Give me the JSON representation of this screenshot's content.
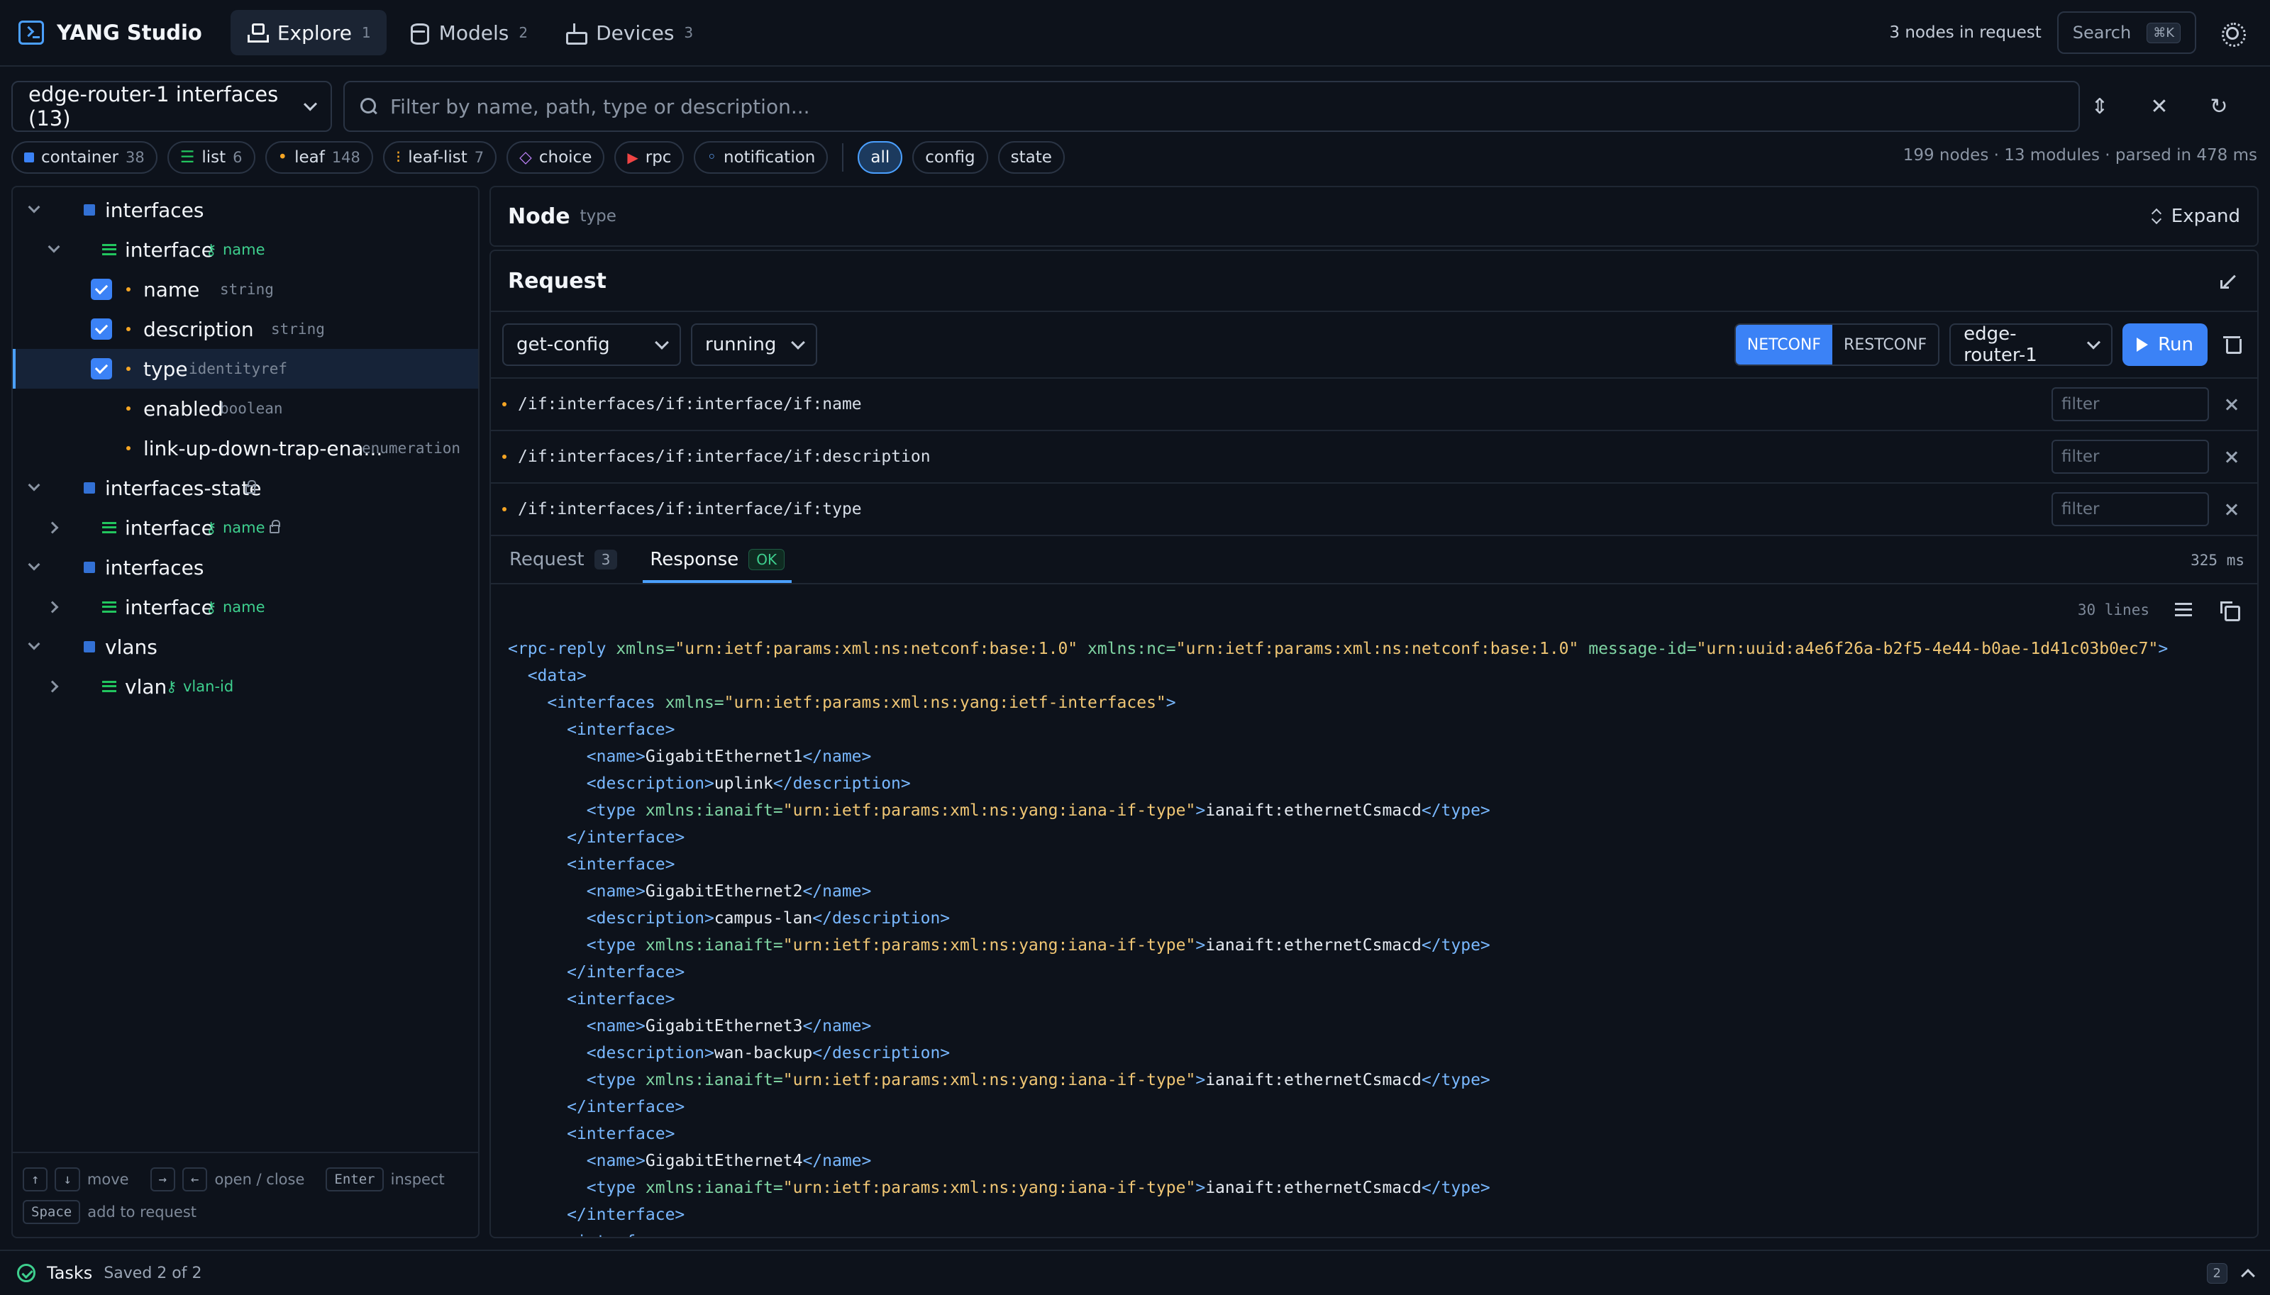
{
  "app": {
    "name": "YANG Studio"
  },
  "nav": {
    "tabs": [
      {
        "label": "Explore",
        "count": "1"
      },
      {
        "label": "Models",
        "count": "2"
      },
      {
        "label": "Devices",
        "count": "3"
      }
    ],
    "request_count": "3 nodes in request",
    "search_label": "Search",
    "search_shortcut": "⌘K"
  },
  "toolbar": {
    "selector": "edge-router-1 interfaces (13)",
    "filter_placeholder": "Filter by name, path, type or description..."
  },
  "chips": {
    "kinds": [
      {
        "label": "container",
        "count": "38"
      },
      {
        "label": "list",
        "count": "6"
      },
      {
        "label": "leaf",
        "count": "148"
      },
      {
        "label": "leaf-list",
        "count": "7"
      },
      {
        "label": "choice",
        "count": ""
      },
      {
        "label": "rpc",
        "count": ""
      },
      {
        "label": "notification",
        "count": ""
      }
    ],
    "modes": [
      "all",
      "config",
      "state"
    ],
    "stats": "199 nodes · 13 modules · parsed in 478 ms"
  },
  "tree": {
    "items": [
      {
        "label": "interfaces"
      },
      {
        "label": "interface",
        "key": "name"
      },
      {
        "label": "name",
        "type": "string"
      },
      {
        "label": "description",
        "type": "string"
      },
      {
        "label": "type",
        "type": "identityref"
      },
      {
        "label": "enabled",
        "type": "boolean"
      },
      {
        "label": "link-up-down-trap-ena...",
        "type": "enumeration"
      },
      {
        "label": "interfaces-state"
      },
      {
        "label": "interface",
        "key": "name"
      },
      {
        "label": "interfaces"
      },
      {
        "label": "interface",
        "key": "name"
      },
      {
        "label": "vlans"
      },
      {
        "label": "vlan",
        "key": "vlan-id"
      }
    ],
    "help": {
      "move": "move",
      "open_close": "open / close",
      "enter": "Enter",
      "inspect": "inspect",
      "space": "Space",
      "add": "add to request"
    }
  },
  "node_panel": {
    "title": "Node",
    "subtitle": "type",
    "expand": "Expand"
  },
  "request": {
    "title": "Request",
    "operation": "get-config",
    "datastore": "running",
    "protocols": [
      "NETCONF",
      "RESTCONF"
    ],
    "device": "edge-router-1",
    "run": "Run",
    "paths": [
      "/if:interfaces/if:interface/if:name",
      "/if:interfaces/if:interface/if:description",
      "/if:interfaces/if:interface/if:type"
    ],
    "filter_placeholder": "filter",
    "tabs": {
      "request": "Request",
      "request_count": "3",
      "response": "Response",
      "response_status": "OK"
    },
    "elapsed": "325 ms",
    "lines": "30 lines"
  },
  "response_lines": [
    [
      [
        "t",
        "<rpc-reply "
      ],
      [
        "a",
        "xmlns="
      ],
      [
        "s",
        "\"urn:ietf:params:xml:ns:netconf:base:1.0\""
      ],
      [
        "a",
        " xmlns:nc="
      ],
      [
        "s",
        "\"urn:ietf:params:xml:ns:netconf:base:1.0\""
      ],
      [
        "a",
        " message-id="
      ],
      [
        "s",
        "\"urn:uuid:a4e6f26a-b2f5-4e44-b0ae-1d41c03b0ec7\""
      ],
      [
        "t",
        ">"
      ]
    ],
    [
      [
        "x",
        "  "
      ],
      [
        "t",
        "<data>"
      ]
    ],
    [
      [
        "x",
        "    "
      ],
      [
        "t",
        "<interfaces "
      ],
      [
        "a",
        "xmlns="
      ],
      [
        "s",
        "\"urn:ietf:params:xml:ns:yang:ietf-interfaces\""
      ],
      [
        "t",
        ">"
      ]
    ],
    [
      [
        "x",
        "      "
      ],
      [
        "t",
        "<interface>"
      ]
    ],
    [
      [
        "x",
        "        "
      ],
      [
        "t",
        "<name>"
      ],
      [
        "x",
        "GigabitEthernet1"
      ],
      [
        "t",
        "</name>"
      ]
    ],
    [
      [
        "x",
        "        "
      ],
      [
        "t",
        "<description>"
      ],
      [
        "x",
        "uplink"
      ],
      [
        "t",
        "</description>"
      ]
    ],
    [
      [
        "x",
        "        "
      ],
      [
        "t",
        "<type "
      ],
      [
        "a",
        "xmlns:ianaift="
      ],
      [
        "s",
        "\"urn:ietf:params:xml:ns:yang:iana-if-type\""
      ],
      [
        "t",
        ">"
      ],
      [
        "x",
        "ianaift:ethernetCsmacd"
      ],
      [
        "t",
        "</type>"
      ]
    ],
    [
      [
        "x",
        "      "
      ],
      [
        "t",
        "</interface>"
      ]
    ],
    [
      [
        "x",
        "      "
      ],
      [
        "t",
        "<interface>"
      ]
    ],
    [
      [
        "x",
        "        "
      ],
      [
        "t",
        "<name>"
      ],
      [
        "x",
        "GigabitEthernet2"
      ],
      [
        "t",
        "</name>"
      ]
    ],
    [
      [
        "x",
        "        "
      ],
      [
        "t",
        "<description>"
      ],
      [
        "x",
        "campus-lan"
      ],
      [
        "t",
        "</description>"
      ]
    ],
    [
      [
        "x",
        "        "
      ],
      [
        "t",
        "<type "
      ],
      [
        "a",
        "xmlns:ianaift="
      ],
      [
        "s",
        "\"urn:ietf:params:xml:ns:yang:iana-if-type\""
      ],
      [
        "t",
        ">"
      ],
      [
        "x",
        "ianaift:ethernetCsmacd"
      ],
      [
        "t",
        "</type>"
      ]
    ],
    [
      [
        "x",
        "      "
      ],
      [
        "t",
        "</interface>"
      ]
    ],
    [
      [
        "x",
        "      "
      ],
      [
        "t",
        "<interface>"
      ]
    ],
    [
      [
        "x",
        "        "
      ],
      [
        "t",
        "<name>"
      ],
      [
        "x",
        "GigabitEthernet3"
      ],
      [
        "t",
        "</name>"
      ]
    ],
    [
      [
        "x",
        "        "
      ],
      [
        "t",
        "<description>"
      ],
      [
        "x",
        "wan-backup"
      ],
      [
        "t",
        "</description>"
      ]
    ],
    [
      [
        "x",
        "        "
      ],
      [
        "t",
        "<type "
      ],
      [
        "a",
        "xmlns:ianaift="
      ],
      [
        "s",
        "\"urn:ietf:params:xml:ns:yang:iana-if-type\""
      ],
      [
        "t",
        ">"
      ],
      [
        "x",
        "ianaift:ethernetCsmacd"
      ],
      [
        "t",
        "</type>"
      ]
    ],
    [
      [
        "x",
        "      "
      ],
      [
        "t",
        "</interface>"
      ]
    ],
    [
      [
        "x",
        "      "
      ],
      [
        "t",
        "<interface>"
      ]
    ],
    [
      [
        "x",
        "        "
      ],
      [
        "t",
        "<name>"
      ],
      [
        "x",
        "GigabitEthernet4"
      ],
      [
        "t",
        "</name>"
      ]
    ],
    [
      [
        "x",
        "        "
      ],
      [
        "t",
        "<type "
      ],
      [
        "a",
        "xmlns:ianaift="
      ],
      [
        "s",
        "\"urn:ietf:params:xml:ns:yang:iana-if-type\""
      ],
      [
        "t",
        ">"
      ],
      [
        "x",
        "ianaift:ethernetCsmacd"
      ],
      [
        "t",
        "</type>"
      ]
    ],
    [
      [
        "x",
        "      "
      ],
      [
        "t",
        "</interface>"
      ]
    ],
    [
      [
        "x",
        "      "
      ],
      [
        "t",
        "<interface>"
      ]
    ]
  ],
  "status": {
    "tasks": "Tasks",
    "saved": "Saved 2 of 2",
    "count": "2"
  },
  "colors": {
    "accent": "#3b82f6",
    "ok": "#3ecf8e",
    "leaf": "#f5a524"
  }
}
